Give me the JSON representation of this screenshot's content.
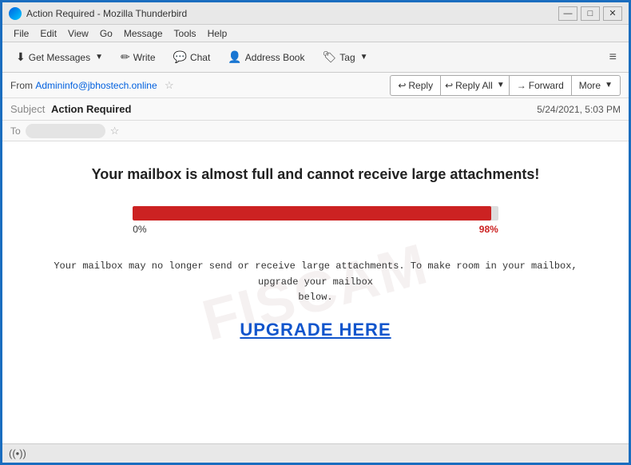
{
  "window": {
    "title": "Action Required - Mozilla Thunderbird",
    "app_icon": "thunderbird"
  },
  "title_bar": {
    "title": "Action Required - Mozilla Thunderbird",
    "minimize": "—",
    "maximize": "□",
    "close": "✕"
  },
  "menu": {
    "items": [
      "File",
      "Edit",
      "View",
      "Go",
      "Message",
      "Tools",
      "Help"
    ]
  },
  "toolbar": {
    "get_messages_label": "Get Messages",
    "write_label": "Write",
    "chat_label": "Chat",
    "address_book_label": "Address Book",
    "tag_label": "Tag",
    "menu_icon": "≡"
  },
  "email_header": {
    "from_label": "From",
    "from_address": "Admininfo@jbhostech.online",
    "star_icon": "☆",
    "reply_label": "Reply",
    "reply_all_label": "Reply All",
    "forward_label": "Forward",
    "more_label": "More",
    "subject_label": "Subject",
    "subject_value": "Action Required",
    "date": "5/24/2021, 5:03 PM",
    "to_label": "To"
  },
  "email_body": {
    "title": "Your mailbox is almost full and cannot receive large attachments!",
    "progress_start": "0%",
    "progress_end": "98%",
    "progress_fill_percent": 98,
    "warning_text": "Your mailbox may no longer send or receive large attachments. To make room in your mailbox, upgrade your mailbox\nbelow.",
    "upgrade_link": "UPGRADE HERE",
    "watermark": "FISCAM"
  },
  "status_bar": {
    "icon": "((•))",
    "text": ""
  },
  "colors": {
    "accent_blue": "#1a6dbf",
    "progress_red": "#cc2222",
    "link_blue": "#1155cc"
  }
}
